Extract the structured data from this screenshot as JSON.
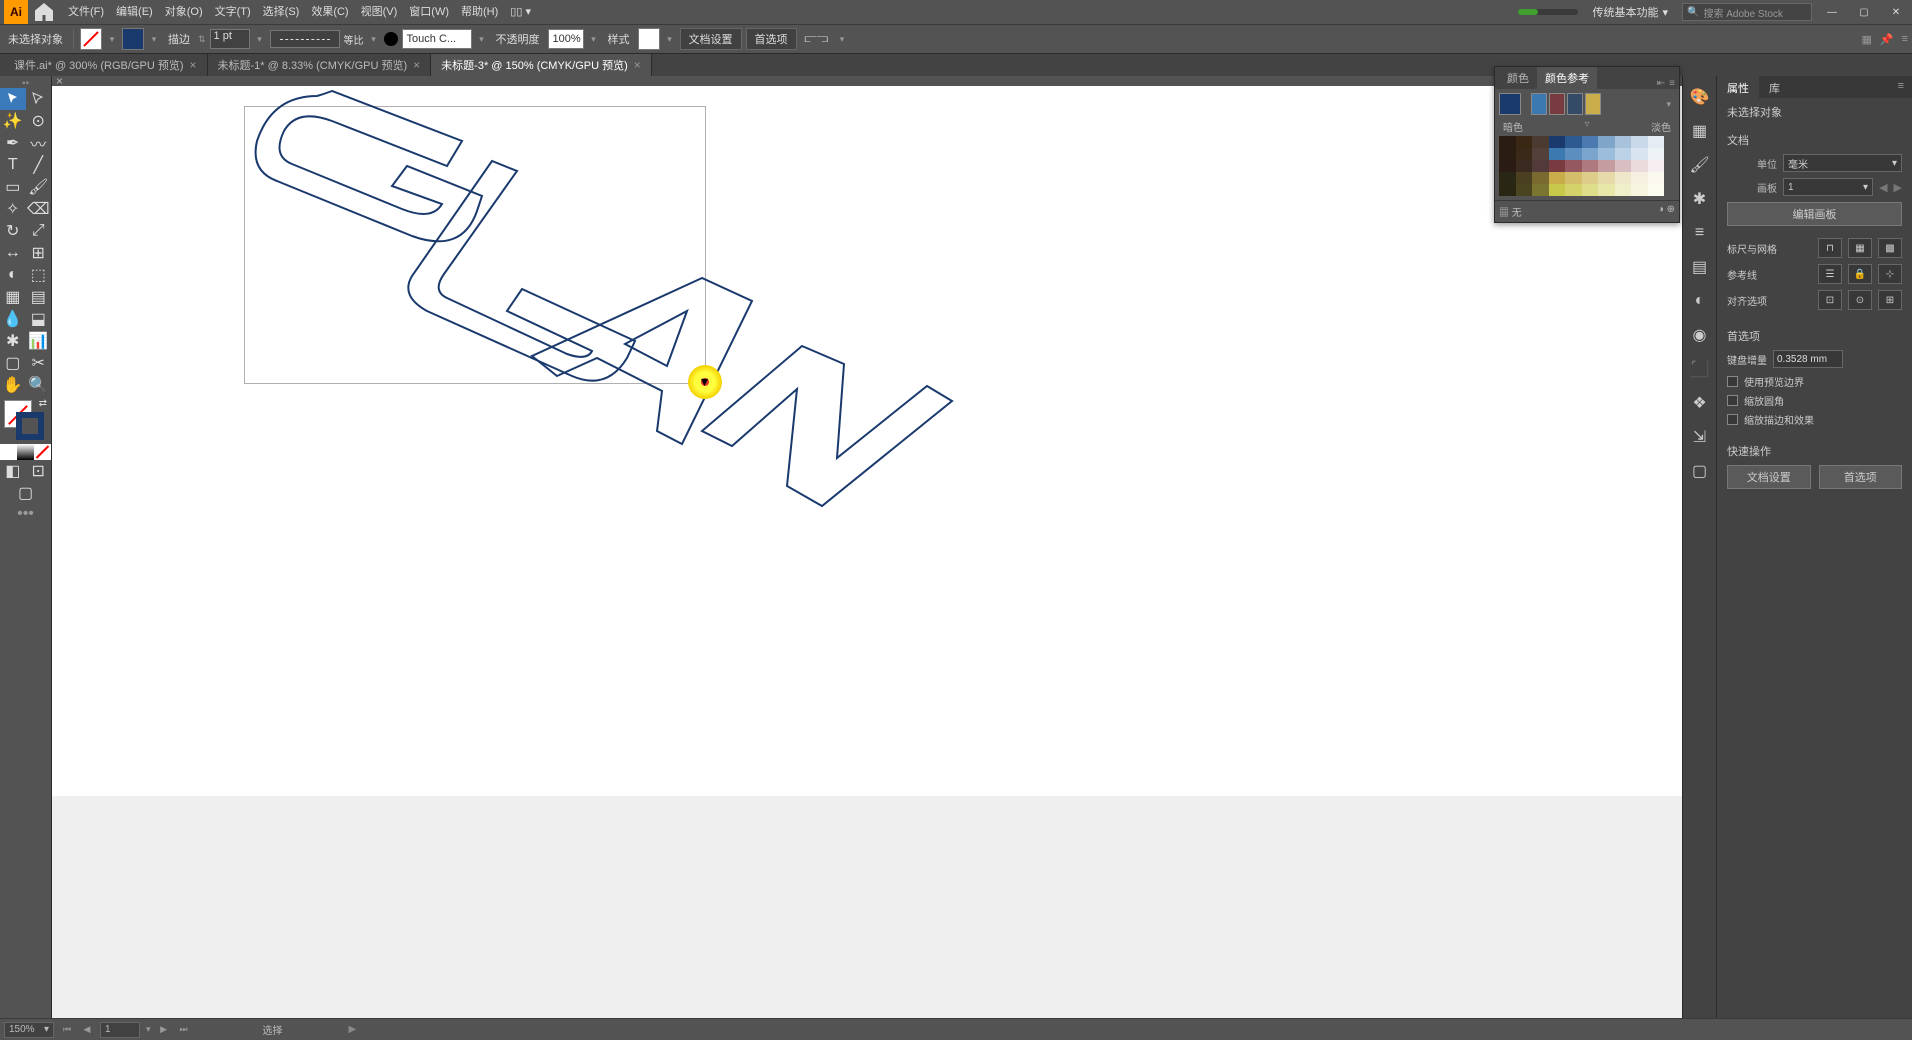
{
  "menubar": {
    "logo": "Ai",
    "items": [
      "文件(F)",
      "编辑(E)",
      "对象(O)",
      "文字(T)",
      "选择(S)",
      "效果(C)",
      "视图(V)",
      "窗口(W)",
      "帮助(H)"
    ],
    "workspace": "传统基本功能",
    "search_placeholder": "搜索 Adobe Stock"
  },
  "controlbar": {
    "selection_label": "未选择对象",
    "stroke_label": "描边",
    "stroke_value": "1 pt",
    "stroke_type": "等比",
    "brush_label": "Touch C...",
    "opacity_label": "不透明度",
    "opacity_value": "100%",
    "style_label": "样式",
    "doc_setup": "文档设置",
    "prefs": "首选项"
  },
  "tabs": [
    {
      "label": "课件.ai* @ 300% (RGB/GPU 预览)",
      "active": false
    },
    {
      "label": "未标题-1* @ 8.33% (CMYK/GPU 预览)",
      "active": false
    },
    {
      "label": "未标题-3* @ 150% (CMYK/GPU 预览)",
      "active": true
    }
  ],
  "color_panel": {
    "tab_color": "颜色",
    "tab_guide": "颜色参考",
    "shade_dark": "暗色",
    "shade_light": "淡色",
    "bottom_left": "无",
    "base_colors": [
      "#1a3a6e",
      "#3c79b0",
      "#7a3b40",
      "#334b66",
      "#c8ad4a"
    ]
  },
  "props": {
    "tab_props": "属性",
    "tab_lib": "库",
    "no_selection": "未选择对象",
    "section_doc": "文档",
    "unit_label": "单位",
    "unit_value": "毫米",
    "artboard_label": "画板",
    "artboard_value": "1",
    "edit_artboard": "编辑画板",
    "section_ruler": "标尺与网格",
    "section_guides": "参考线",
    "section_align": "对齐选项",
    "section_prefs": "首选项",
    "key_inc_label": "键盘增量",
    "key_inc_value": "0.3528 mm",
    "chk_preview": "使用预览边界",
    "chk_corner": "缩放圆角",
    "chk_scale": "缩放描边和效果",
    "section_quick": "快速操作",
    "btn_doc_setup": "文档设置",
    "btn_prefs": "首选项"
  },
  "statusbar": {
    "zoom": "150%",
    "artboard": "1",
    "tool": "选择"
  },
  "grid_colors": [
    [
      "#2a1c10",
      "#3a2815",
      "#4b3a30",
      "#1a3a6e",
      "#2d5a90",
      "#4a7ab0",
      "#7fa5c9",
      "#a8c2dc",
      "#c9d9ea",
      "#e5ecf4"
    ],
    [
      "#2a1c10",
      "#3a2818",
      "#53403a",
      "#3c79b0",
      "#5c8fc0",
      "#7ca5cd",
      "#9cbddb",
      "#bcd3e7",
      "#d8e4f0",
      "#eef3f8"
    ],
    [
      "#2a1c14",
      "#3a2a20",
      "#533a3a",
      "#7a3b40",
      "#965860",
      "#ae7a80",
      "#c59ca0",
      "#dabfc2",
      "#ebdbdd",
      "#f6eef0"
    ],
    [
      "#2a2616",
      "#4a4020",
      "#7a6a30",
      "#c8ad4a",
      "#d3bd6a",
      "#ddcc8a",
      "#e7daaa",
      "#efe7ca",
      "#f6f0e0",
      "#fbf8f0"
    ],
    [
      "#2a2614",
      "#4a4520",
      "#7a7530",
      "#c8c84a",
      "#d3d36a",
      "#dddd8a",
      "#e7e7aa",
      "#efefca",
      "#f6f6e0",
      "#fbfbf0"
    ]
  ]
}
